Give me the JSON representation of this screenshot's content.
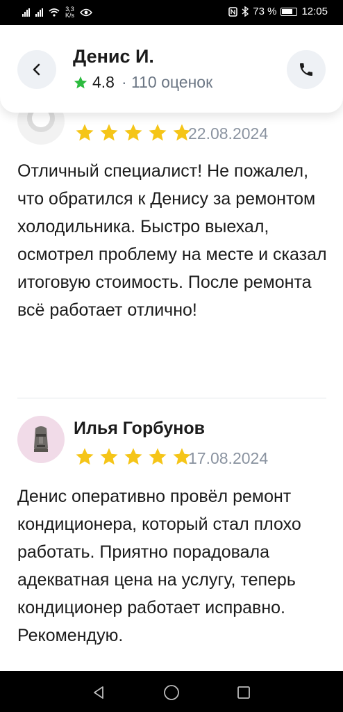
{
  "status_bar": {
    "speed_value": "3,3",
    "speed_unit": "K/s",
    "battery": "73 %",
    "time": "12:05"
  },
  "header": {
    "name": "Денис И.",
    "rating": "4.8",
    "rating_count": "· 110 оценок",
    "icons": [
      "chevron-left-icon",
      "phone-icon",
      "star-icon"
    ],
    "colors": {
      "star": "#2cbb3f",
      "button_bg": "#eef1f5"
    }
  },
  "reviews": [
    {
      "author": "",
      "stars": 5,
      "date": "22.08.2024",
      "text": "Отличный специалист! Не пожалел, что обратился к Денису за ремонтом холодильника. Быстро выехал, осмотрел проблему на месте и сказал итоговую стоимость. После ремонта всё работает отлично!"
    },
    {
      "author": "Илья Горбунов",
      "stars": 5,
      "date": "17.08.2024",
      "text": "Денис оперативно провёл ремонт кондиционера, который стал плохо работать. Приятно порадовала адекватная цена на услугу, теперь кондиционер работает исправно. Рекомендую."
    }
  ],
  "colors": {
    "review_star": "#f5c518",
    "avatar_pink": "#f1dbe8"
  },
  "navbar": {
    "icons": [
      "back-triangle-icon",
      "home-circle-icon",
      "recents-square-icon"
    ]
  }
}
